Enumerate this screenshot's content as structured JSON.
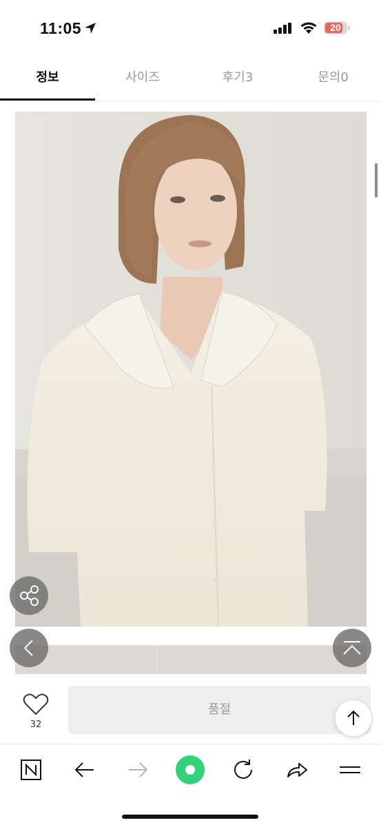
{
  "status_bar": {
    "time": "11:05",
    "battery": "20",
    "location_icon": "location-arrow-icon",
    "signal_icon": "cellular-signal-icon",
    "wifi_icon": "wifi-icon"
  },
  "tabs": [
    {
      "label": "정보",
      "active": true
    },
    {
      "label": "사이즈",
      "active": false
    },
    {
      "label": "후기3",
      "active": false
    },
    {
      "label": "문의0",
      "active": false
    }
  ],
  "product": {
    "like_count": "32",
    "soldout_label": "품절"
  },
  "colors": {
    "battery_low": "#e5675a",
    "browser_green": "#33d17a",
    "overlay_button": "#6e6e6e"
  }
}
